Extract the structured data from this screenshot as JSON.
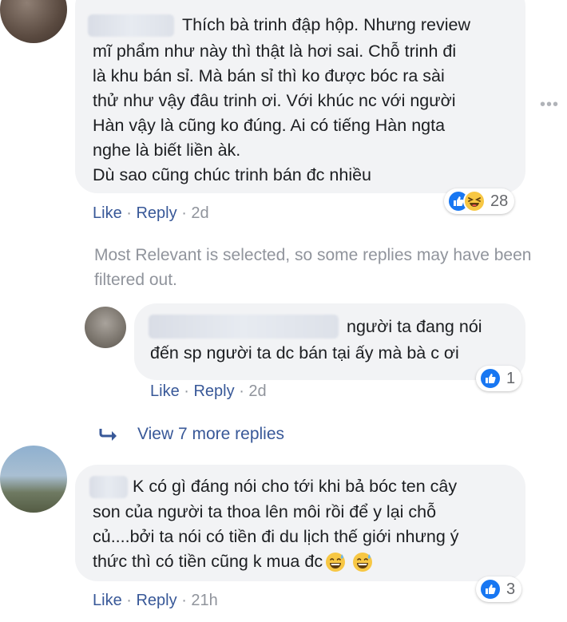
{
  "comments": [
    {
      "text_lines": [
        "Thích bà trinh đập hộp. Nhưng review",
        "mĩ phẩm như này thì thật là hơi sai. Chỗ trinh đi",
        "là khu bán sỉ. Mà bán sỉ thì ko được bóc ra sài",
        "thử như vậy đâu trinh ơi. Với khúc nc với người",
        "Hàn vậy là cũng ko đúng. Ai có tiếng Hàn ngta",
        "nghe là biết liền àk.",
        "Dù sao cũng chúc trinh bán đc nhiều"
      ],
      "like_label": "Like",
      "reply_label": "Reply",
      "separator": "·",
      "time": "2d",
      "reaction_icons": [
        "like-icon",
        "haha-icon"
      ],
      "reaction_count": "28"
    },
    {
      "text_lines": [
        "người ta đang nói",
        "đến sp người ta dc bán tại ấy mà bà c ơi"
      ],
      "like_label": "Like",
      "reply_label": "Reply",
      "separator": "·",
      "time": "2d",
      "reaction_icons": [
        "like-icon"
      ],
      "reaction_count": "1"
    },
    {
      "text_lines": [
        "K có gì đáng nói cho tới khi bả bóc ten cây",
        "son của người ta thoa lên môi rồi để y lại chỗ",
        "củ....bởi ta nói có tiền đi du lịch thế giới nhưng ý",
        "thức thì có tiền cũng k mua đc"
      ],
      "like_label": "Like",
      "reply_label": "Reply",
      "separator": "·",
      "time": "21h",
      "reaction_icons": [
        "like-icon"
      ],
      "reaction_count": "3"
    }
  ],
  "filter_note": "Most Relevant is selected, so some replies may have been filtered out.",
  "view_more_replies": "View 7 more replies",
  "menu_icon": "more-options-icon",
  "colors": {
    "link": "#385898",
    "muted": "#90949c",
    "bubble": "#f2f3f5",
    "like_blue": "#1877f2"
  }
}
